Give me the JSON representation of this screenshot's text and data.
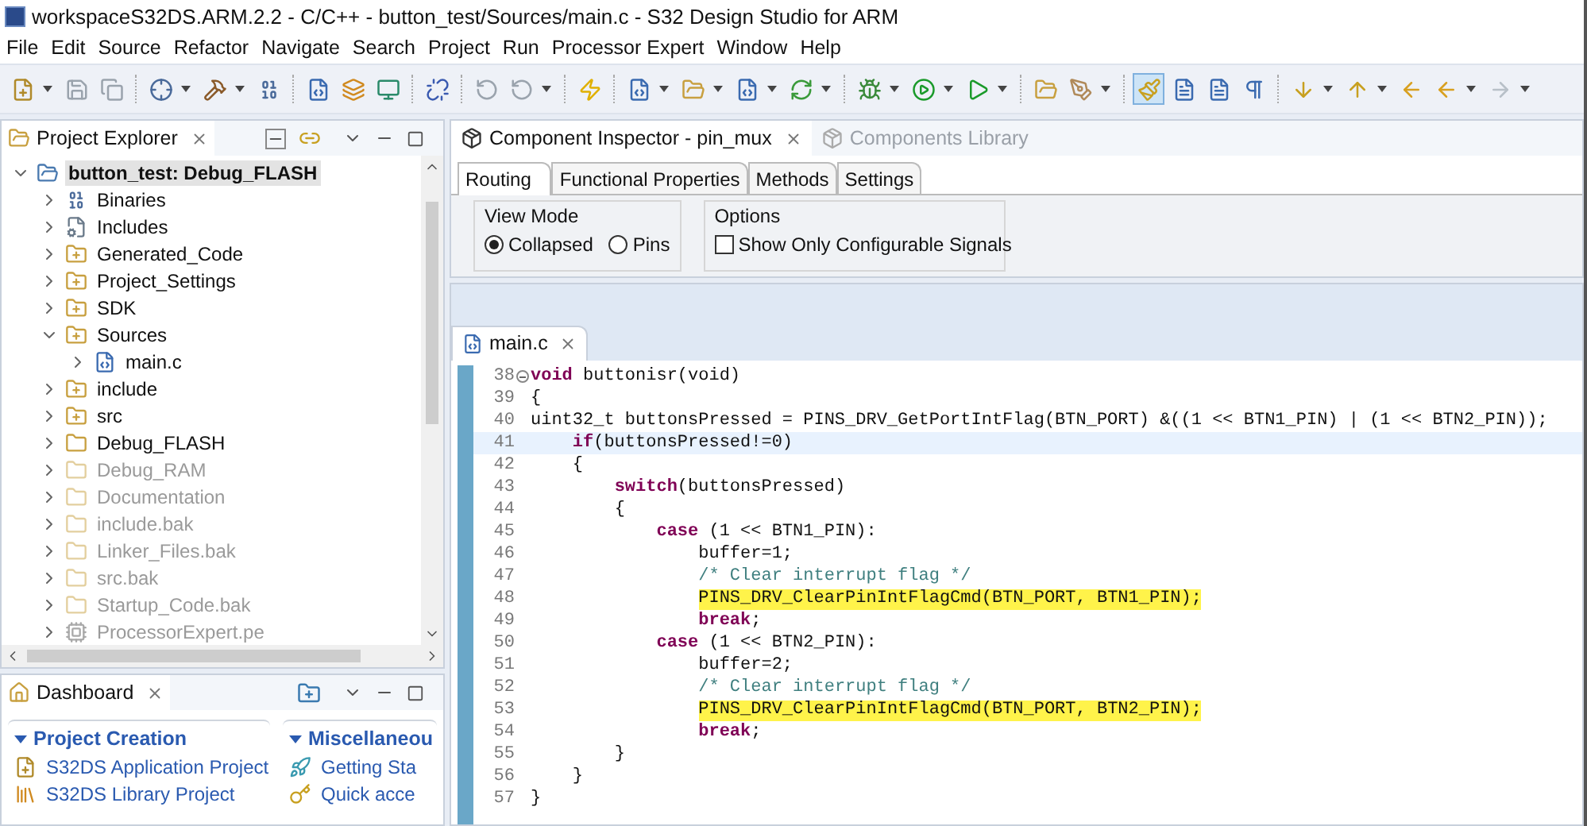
{
  "window": {
    "title": "workspaceS32DS.ARM.2.2 - C/C++ - button_test/Sources/main.c - S32 Design Studio for ARM"
  },
  "menu": [
    "File",
    "Edit",
    "Source",
    "Refactor",
    "Navigate",
    "Search",
    "Project",
    "Run",
    "Processor Expert",
    "Window",
    "Help"
  ],
  "toolbar": [
    {
      "kind": "new",
      "dropdown": true,
      "selected": false
    },
    {
      "kind": "save",
      "dropdown": false,
      "selected": false
    },
    {
      "kind": "save-all",
      "dropdown": false,
      "selected": false
    },
    {
      "kind": "sep"
    },
    {
      "kind": "target",
      "dropdown": true,
      "selected": false
    },
    {
      "kind": "hammer",
      "dropdown": true,
      "selected": false
    },
    {
      "kind": "binary",
      "dropdown": false,
      "selected": false
    },
    {
      "kind": "sep"
    },
    {
      "kind": "new-file",
      "dropdown": false,
      "selected": false
    },
    {
      "kind": "layers",
      "dropdown": false,
      "selected": false
    },
    {
      "kind": "monitor",
      "dropdown": false,
      "selected": false
    },
    {
      "kind": "sep"
    },
    {
      "kind": "unlink",
      "dropdown": false,
      "selected": false
    },
    {
      "kind": "sep"
    },
    {
      "kind": "replay",
      "dropdown": false,
      "selected": false
    },
    {
      "kind": "replay",
      "dropdown": true,
      "selected": false
    },
    {
      "kind": "sep"
    },
    {
      "kind": "bolt",
      "dropdown": false,
      "selected": false
    },
    {
      "kind": "sep"
    },
    {
      "kind": "new-file",
      "dropdown": true,
      "selected": false
    },
    {
      "kind": "folder",
      "dropdown": true,
      "selected": false
    },
    {
      "kind": "new-file",
      "dropdown": true,
      "selected": false
    },
    {
      "kind": "refresh",
      "dropdown": true,
      "selected": false
    },
    {
      "kind": "sep"
    },
    {
      "kind": "bug",
      "dropdown": true,
      "selected": false
    },
    {
      "kind": "run",
      "dropdown": true,
      "selected": false
    },
    {
      "kind": "run-ext",
      "dropdown": true,
      "selected": false
    },
    {
      "kind": "sep"
    },
    {
      "kind": "folder",
      "dropdown": false,
      "selected": false
    },
    {
      "kind": "pen",
      "dropdown": true,
      "selected": false
    },
    {
      "kind": "sep"
    },
    {
      "kind": "brush",
      "dropdown": false,
      "selected": true
    },
    {
      "kind": "doc",
      "dropdown": false,
      "selected": false
    },
    {
      "kind": "doc",
      "dropdown": false,
      "selected": false
    },
    {
      "kind": "pilcrow",
      "dropdown": false,
      "selected": false
    },
    {
      "kind": "sep"
    },
    {
      "kind": "down",
      "dropdown": true,
      "selected": false
    },
    {
      "kind": "up",
      "dropdown": true,
      "selected": false
    },
    {
      "kind": "back-star",
      "dropdown": false,
      "selected": false
    },
    {
      "kind": "back",
      "dropdown": true,
      "selected": false
    },
    {
      "kind": "forward",
      "dropdown": true,
      "selected": false
    }
  ],
  "project_explorer": {
    "title": "Project Explorer",
    "tree": [
      {
        "label": "button_test: Debug_FLASH",
        "kind": "project",
        "expanded": true,
        "disabled": false,
        "selected": true,
        "children": [
          {
            "label": "Binaries",
            "kind": "binaries",
            "expanded": false,
            "disabled": false,
            "selected": false
          },
          {
            "label": "Includes",
            "kind": "includes",
            "expanded": false,
            "disabled": false,
            "selected": false
          },
          {
            "label": "Generated_Code",
            "kind": "source-folder",
            "expanded": false,
            "disabled": false,
            "selected": false
          },
          {
            "label": "Project_Settings",
            "kind": "source-folder",
            "expanded": false,
            "disabled": false,
            "selected": false
          },
          {
            "label": "SDK",
            "kind": "source-folder",
            "expanded": false,
            "disabled": false,
            "selected": false
          },
          {
            "label": "Sources",
            "kind": "source-folder",
            "expanded": true,
            "disabled": false,
            "selected": false,
            "children": [
              {
                "label": "main.c",
                "kind": "c-file",
                "expanded": false,
                "disabled": false,
                "selected": false
              }
            ]
          },
          {
            "label": "include",
            "kind": "source-folder",
            "expanded": false,
            "disabled": false,
            "selected": false
          },
          {
            "label": "src",
            "kind": "source-folder",
            "expanded": false,
            "disabled": false,
            "selected": false
          },
          {
            "label": "Debug_FLASH",
            "kind": "folder",
            "expanded": false,
            "disabled": false,
            "selected": false
          },
          {
            "label": "Debug_RAM",
            "kind": "folder",
            "expanded": false,
            "disabled": true,
            "selected": false
          },
          {
            "label": "Documentation",
            "kind": "folder",
            "expanded": false,
            "disabled": true,
            "selected": false
          },
          {
            "label": "include.bak",
            "kind": "folder",
            "expanded": false,
            "disabled": true,
            "selected": false
          },
          {
            "label": "Linker_Files.bak",
            "kind": "folder",
            "expanded": false,
            "disabled": true,
            "selected": false
          },
          {
            "label": "src.bak",
            "kind": "folder",
            "expanded": false,
            "disabled": true,
            "selected": false
          },
          {
            "label": "Startup_Code.bak",
            "kind": "folder",
            "expanded": false,
            "disabled": true,
            "selected": false
          },
          {
            "label": "ProcessorExpert.pe",
            "kind": "pe-file",
            "expanded": false,
            "disabled": true,
            "selected": false
          }
        ]
      }
    ]
  },
  "dashboard": {
    "title": "Dashboard",
    "sections": [
      {
        "title": "Project Creation",
        "items": [
          {
            "label": "S32DS Application Project",
            "kind": "new-project"
          },
          {
            "label": "S32DS Library Project",
            "kind": "library"
          }
        ]
      },
      {
        "title": "Miscellaneou",
        "items": [
          {
            "label": "Getting Sta",
            "kind": "start"
          },
          {
            "label": "Quick acce",
            "kind": "key"
          }
        ]
      }
    ]
  },
  "inspector": {
    "tabs": [
      {
        "label": "Component Inspector - pin_mux",
        "selected": true
      },
      {
        "label": "Components Library",
        "selected": false
      }
    ],
    "subtabs": [
      {
        "label": "Routing",
        "selected": true
      },
      {
        "label": "Functional Properties",
        "selected": false
      },
      {
        "label": "Methods",
        "selected": false
      },
      {
        "label": "Settings",
        "selected": false
      }
    ],
    "view_mode": {
      "title": "View Mode",
      "options": [
        {
          "label": "Collapsed",
          "selected": true
        },
        {
          "label": "Pins",
          "selected": false
        }
      ]
    },
    "options": {
      "title": "Options",
      "checkbox": {
        "label": "Show Only Configurable Signals",
        "checked": false
      }
    }
  },
  "editor": {
    "tab": "main.c",
    "lines": [
      {
        "number": "38",
        "text": "**void** buttonisr(void)",
        "kind": "code",
        "fold": true,
        "current": false,
        "highlighted": false
      },
      {
        "number": "39",
        "text": "{",
        "kind": "code",
        "fold": false,
        "current": false,
        "highlighted": false
      },
      {
        "number": "40",
        "text": "uint32_t buttonsPressed = PINS_DRV_GetPortIntFlag(BTN_PORT) &((1 << BTN1_PIN) | (1 << BTN2_PIN));",
        "kind": "code",
        "fold": false,
        "current": false,
        "highlighted": false
      },
      {
        "number": "41",
        "text": "    **if**(buttonsPressed!=0)",
        "kind": "code",
        "fold": false,
        "current": true,
        "highlighted": false
      },
      {
        "number": "42",
        "text": "    {",
        "kind": "code",
        "fold": false,
        "current": false,
        "highlighted": false
      },
      {
        "number": "43",
        "text": "        **switch**(buttonsPressed)",
        "kind": "code",
        "fold": false,
        "current": false,
        "highlighted": false
      },
      {
        "number": "44",
        "text": "        {",
        "kind": "code",
        "fold": false,
        "current": false,
        "highlighted": false
      },
      {
        "number": "45",
        "text": "            **case** (1 << BTN1_PIN):",
        "kind": "code",
        "fold": false,
        "current": false,
        "highlighted": false
      },
      {
        "number": "46",
        "text": "                buffer=1;",
        "kind": "code",
        "fold": false,
        "current": false,
        "highlighted": false
      },
      {
        "number": "47",
        "text": "                /* Clear interrupt flag */",
        "kind": "comment",
        "fold": false,
        "current": false,
        "highlighted": false
      },
      {
        "number": "48",
        "text": "                PINS_DRV_ClearPinIntFlagCmd(BTN_PORT, BTN1_PIN);",
        "kind": "code",
        "fold": false,
        "current": false,
        "highlighted": true
      },
      {
        "number": "49",
        "text": "                **break**;",
        "kind": "code",
        "fold": false,
        "current": false,
        "highlighted": false
      },
      {
        "number": "50",
        "text": "            **case** (1 << BTN2_PIN):",
        "kind": "code",
        "fold": false,
        "current": false,
        "highlighted": false
      },
      {
        "number": "51",
        "text": "                buffer=2;",
        "kind": "code",
        "fold": false,
        "current": false,
        "highlighted": false
      },
      {
        "number": "52",
        "text": "                /* Clear interrupt flag */",
        "kind": "comment",
        "fold": false,
        "current": false,
        "highlighted": false
      },
      {
        "number": "53",
        "text": "                PINS_DRV_ClearPinIntFlagCmd(BTN_PORT, BTN2_PIN);",
        "kind": "code",
        "fold": false,
        "current": false,
        "highlighted": true
      },
      {
        "number": "54",
        "text": "                **break**;",
        "kind": "code",
        "fold": false,
        "current": false,
        "highlighted": false
      },
      {
        "number": "55",
        "text": "        }",
        "kind": "code",
        "fold": false,
        "current": false,
        "highlighted": false
      },
      {
        "number": "56",
        "text": "    }",
        "kind": "code",
        "fold": false,
        "current": false,
        "highlighted": false
      },
      {
        "number": "57",
        "text": "}",
        "kind": "code",
        "fold": false,
        "current": false,
        "highlighted": false
      }
    ]
  }
}
